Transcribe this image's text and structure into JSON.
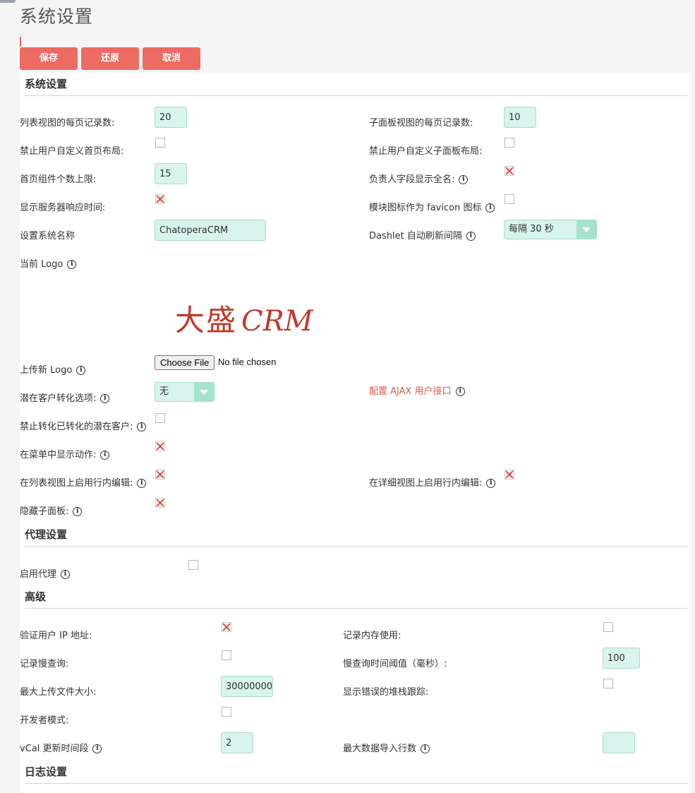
{
  "page_title": "系统设置",
  "buttons": {
    "save": "保存",
    "restore": "还原",
    "cancel": "取消"
  },
  "system_section": {
    "title": "系统设置",
    "list_records_label": "列表视图的每页记录数:",
    "list_records_value": "20",
    "subpanel_records_label": "子面板视图的每页记录数:",
    "subpanel_records_value": "10",
    "disable_home_layout_label": "禁止用户自定义首页布局:",
    "disable_home_layout_checked": false,
    "disable_subpanel_layout_label": "禁止用户自定义子面板布局:",
    "disable_subpanel_layout_checked": false,
    "max_dashlets_label": "首页组件个数上限:",
    "max_dashlets_value": "15",
    "assigned_fullname_label": "负责人字段显示全名:",
    "assigned_fullname_checked": true,
    "show_response_time_label": "显示服务器响应时间:",
    "show_response_time_checked": true,
    "module_favicon_label": "模块图标作为 favicon 图标",
    "module_favicon_checked": false,
    "system_name_label": "设置系统名称",
    "system_name_value": "ChatoperaCRM",
    "dashlet_refresh_label": "Dashlet 自动刷新间隔",
    "dashlet_refresh_value": "每隔 30 秒",
    "current_logo_label": "当前 Logo",
    "logo_cn": "大盛",
    "logo_en": "CRM",
    "upload_logo_label": "上传新 Logo",
    "choose_file_label": "Choose File",
    "no_file_label": "No file chosen",
    "lead_conversion_label": "潜在客户转化选项:",
    "lead_conversion_value": "无",
    "ajax_link_label": "配置 AJAX 用户接口",
    "disable_convert_label": "禁止转化已转化的潜在客户:",
    "disable_convert_checked": false,
    "show_actions_menu_label": "在菜单中显示动作:",
    "show_actions_menu_checked": true,
    "inline_edit_list_label": "在列表视图上启用行内编辑:",
    "inline_edit_list_checked": true,
    "inline_edit_detail_label": "在详细视图上启用行内编辑:",
    "inline_edit_detail_checked": true,
    "hide_subpanels_label": "隐藏子面板:",
    "hide_subpanels_checked": true
  },
  "proxy_section": {
    "title": "代理设置",
    "enable_proxy_label": "启用代理",
    "enable_proxy_checked": false
  },
  "advanced_section": {
    "title": "高级",
    "validate_ip_label": "验证用户 IP 地址:",
    "validate_ip_checked": true,
    "log_memory_label": "记录内存使用:",
    "log_memory_checked": false,
    "log_slow_queries_label": "记录慢查询:",
    "log_slow_queries_checked": false,
    "slow_query_threshold_label": "慢查询时间阈值（毫秒）:",
    "slow_query_threshold_value": "100",
    "max_upload_label": "最大上传文件大小:",
    "max_upload_value": "30000000",
    "stack_trace_label": "显示错误的堆栈跟踪:",
    "stack_trace_checked": false,
    "developer_mode_label": "开发者模式:",
    "developer_mode_checked": false,
    "vcal_label": "vCal 更新时间段",
    "vcal_value": "2",
    "max_import_label": "最大数据导入行数",
    "max_import_value": ""
  },
  "log_section": {
    "title": "日志设置"
  },
  "colors": {
    "accent": "#ec6c63",
    "input_bg": "#d8f4ec",
    "link": "#e0584f"
  }
}
